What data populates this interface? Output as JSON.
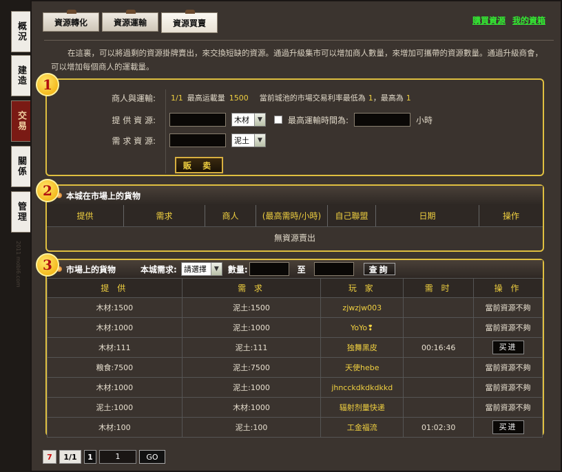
{
  "sidenav": {
    "items": [
      {
        "label": "概況",
        "active": false
      },
      {
        "label": "建造",
        "active": false
      },
      {
        "label": "交易",
        "active": true
      },
      {
        "label": "關係",
        "active": false
      },
      {
        "label": "管理",
        "active": false
      }
    ],
    "watermark": "2011 mobi6.com"
  },
  "tabs": [
    {
      "label": "資源轉化",
      "active": false
    },
    {
      "label": "資源運輸",
      "active": false
    },
    {
      "label": "資源買賣",
      "active": true
    }
  ],
  "toplinks": {
    "buy": "購買資源",
    "box": "我的資箱"
  },
  "intro": "在這裏，可以將過剩的資源掛牌賣出，來交換短缺的資源。通過升級集市可以增加商人數量，來增加可攜帶的資源數量。通過升級商會，可以增加每個商人的運載量。",
  "badges": [
    "1",
    "2",
    "3"
  ],
  "sell": {
    "merchant_label": "商人與運輸:",
    "merchant_count": "1/1",
    "max_load_label": "最高运載量",
    "max_load": "1500",
    "rate_text_1": "當前城池的市場交易利率最低為",
    "rate_min": "1",
    "rate_text_2": "，最高為",
    "rate_max": "1",
    "offer_label": "提 供 資 源:",
    "offer_resource": "木材",
    "max_time_label": "最高運輸時間為:",
    "hours_unit": "小時",
    "need_label": "需 求 資 源:",
    "need_resource": "泥土",
    "sell_button": "販 卖"
  },
  "own_goods": {
    "title": "本城在市場上的貨物",
    "columns": [
      "提供",
      "需求",
      "商人",
      "(最高需時/小時)",
      "自己聯盟",
      "日期",
      "操作"
    ],
    "empty": "無資源賣出"
  },
  "market": {
    "title": "市場上的貨物",
    "need_label": "本城需求:",
    "need_select": "請選擇",
    "qty_label": "數量:",
    "to_label": "至",
    "query_button": "查詢",
    "columns": [
      "提 供",
      "需 求",
      "玩 家",
      "需 时",
      "操 作"
    ],
    "rows": [
      {
        "offer": "木材:1500",
        "need": "泥土:1500",
        "player": "zjwzjw003",
        "time": "",
        "action": "當前資源不夠",
        "buy": false
      },
      {
        "offer": "木材:1000",
        "need": "泥土:1000",
        "player": "YoYo❢",
        "time": "",
        "action": "當前資源不夠",
        "buy": false
      },
      {
        "offer": "木材:111",
        "need": "泥土:111",
        "player": "独舞黑皮",
        "time": "00:16:46",
        "action": "买进",
        "buy": true
      },
      {
        "offer": "粮食:7500",
        "need": "泥土:7500",
        "player": "天使hebe",
        "time": "",
        "action": "當前資源不夠",
        "buy": false
      },
      {
        "offer": "木材:1000",
        "need": "泥土:1000",
        "player": "jhncckdkdkdkkd",
        "time": "",
        "action": "當前資源不夠",
        "buy": false
      },
      {
        "offer": "泥土:1000",
        "need": "木材:1000",
        "player": "辐射剂量快递",
        "time": "",
        "action": "當前資源不夠",
        "buy": false
      },
      {
        "offer": "木材:100",
        "need": "泥土:100",
        "player": "工金福流",
        "time": "01:02:30",
        "action": "买进",
        "buy": true
      }
    ]
  },
  "pager": {
    "total": "7",
    "pages": "1/1",
    "current": "1",
    "input": "1",
    "go": "GO"
  }
}
